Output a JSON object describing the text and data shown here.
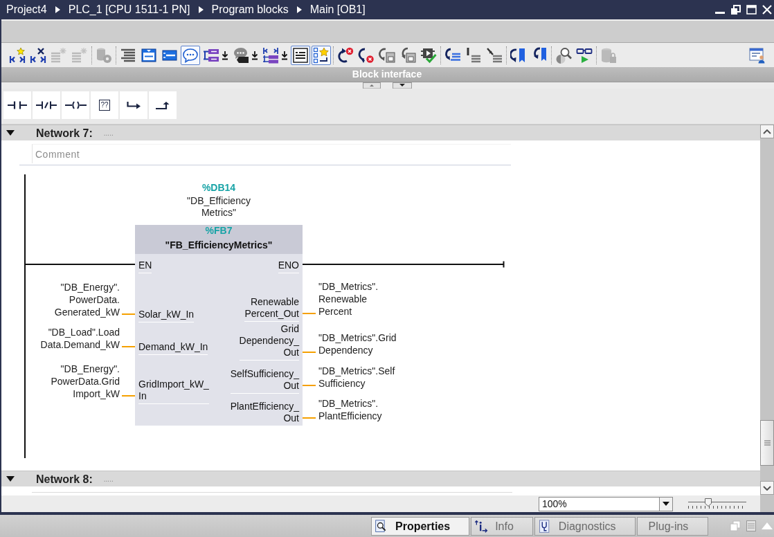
{
  "title_bar": {
    "breadcrumb": [
      "Project4",
      "PLC_1 [CPU 1511-1 PN]",
      "Program blocks",
      "Main [OB1]"
    ]
  },
  "toolbar": {
    "groups": [
      {
        "buttons": [
          {
            "pressed": false,
            "disabled": false,
            "dropdown": false
          },
          {
            "pressed": false,
            "disabled": false,
            "dropdown": false
          },
          {
            "pressed": false,
            "disabled": true,
            "dropdown": false
          },
          {
            "pressed": false,
            "disabled": true,
            "dropdown": false
          }
        ]
      },
      {
        "buttons": [
          {
            "pressed": false,
            "disabled": true,
            "dropdown": false
          }
        ]
      },
      {
        "buttons": [
          {
            "pressed": false,
            "disabled": false,
            "dropdown": false
          },
          {
            "pressed": false,
            "disabled": false,
            "dropdown": false
          },
          {
            "pressed": false,
            "disabled": false,
            "dropdown": false
          },
          {
            "pressed": true,
            "disabled": false,
            "dropdown": false
          },
          {
            "pressed": false,
            "disabled": false,
            "dropdown": true
          },
          {
            "pressed": false,
            "disabled": false,
            "dropdown": true
          },
          {
            "pressed": false,
            "disabled": false,
            "dropdown": true
          },
          {
            "pressed": true,
            "disabled": false,
            "dropdown": false
          },
          {
            "pressed": true,
            "disabled": false,
            "dropdown": false
          }
        ]
      },
      {
        "buttons": [
          {
            "pressed": false,
            "disabled": false,
            "dropdown": false
          },
          {
            "pressed": false,
            "disabled": false,
            "dropdown": false
          },
          {
            "pressed": false,
            "disabled": false,
            "dropdown": false
          },
          {
            "pressed": false,
            "disabled": false,
            "dropdown": false
          },
          {
            "pressed": false,
            "disabled": false,
            "dropdown": false
          }
        ]
      },
      {
        "buttons": [
          {
            "pressed": false,
            "disabled": false,
            "dropdown": false
          },
          {
            "pressed": false,
            "disabled": false,
            "dropdown": false
          },
          {
            "pressed": false,
            "disabled": false,
            "dropdown": false
          }
        ]
      },
      {
        "buttons": [
          {
            "pressed": false,
            "disabled": false,
            "dropdown": false
          },
          {
            "pressed": false,
            "disabled": false,
            "dropdown": false
          }
        ]
      },
      {
        "buttons": [
          {
            "pressed": false,
            "disabled": false,
            "dropdown": false
          },
          {
            "pressed": false,
            "disabled": false,
            "dropdown": false
          }
        ]
      },
      {
        "buttons": [
          {
            "pressed": false,
            "disabled": true,
            "dropdown": false
          }
        ]
      }
    ],
    "end_buttons": [
      {
        "pressed": false,
        "disabled": false,
        "dropdown": false
      }
    ]
  },
  "block_interface": {
    "label": "Block interface"
  },
  "favorites": [
    {
      "kind": "contact"
    },
    {
      "kind": "negated_contact"
    },
    {
      "kind": "coil"
    },
    {
      "kind": "empty_box",
      "text": "??"
    },
    {
      "kind": "open_branch"
    },
    {
      "kind": "close_branch"
    }
  ],
  "networks": [
    {
      "title": "Network 7:",
      "subtitle": ".....",
      "expanded": true,
      "comment_placeholder": "Comment",
      "block": {
        "instance_address": "%DB14",
        "instance_name": "\"DB_Efficiency\nMetrics\"",
        "address": "%FB7",
        "name": "\"FB_EfficiencyMetrics\"",
        "en": "EN",
        "eno": "ENO",
        "inputs": [
          {
            "pin": "Solar_kW_In",
            "operand": "\"DB_Energy\".\nPowerData.\nGenerated_kW"
          },
          {
            "pin": "Demand_kW_In",
            "operand": "\"DB_Load\".Load\nData.Demand_kW"
          },
          {
            "pin": "GridImport_kW_\nIn",
            "operand": "\"DB_Energy\".\nPowerData.Grid\nImport_kW"
          }
        ],
        "outputs": [
          {
            "pin": "Renewable\nPercent_Out",
            "operand": "\"DB_Metrics\".\nRenewable\nPercent"
          },
          {
            "pin": "Grid\nDependency_\nOut",
            "operand": "\"DB_Metrics\".Grid\nDependency"
          },
          {
            "pin": "SelfSufficiency_\nOut",
            "operand": "\"DB_Metrics\".Self\nSufficiency"
          },
          {
            "pin": "PlantEfficiency_\nOut",
            "operand": "\"DB_Metrics\".\nPlantEfficiency"
          }
        ]
      }
    },
    {
      "title": "Network 8:",
      "subtitle": ".....",
      "expanded": true
    }
  ],
  "footer": {
    "zoom": {
      "value": "100%",
      "level": 0.35
    }
  },
  "inspector_tabs": [
    {
      "label": "Properties",
      "selected": true
    },
    {
      "label": "Info",
      "selected": false
    },
    {
      "label": "Diagnostics",
      "selected": false
    },
    {
      "label": "Plug-ins",
      "selected": false
    }
  ]
}
